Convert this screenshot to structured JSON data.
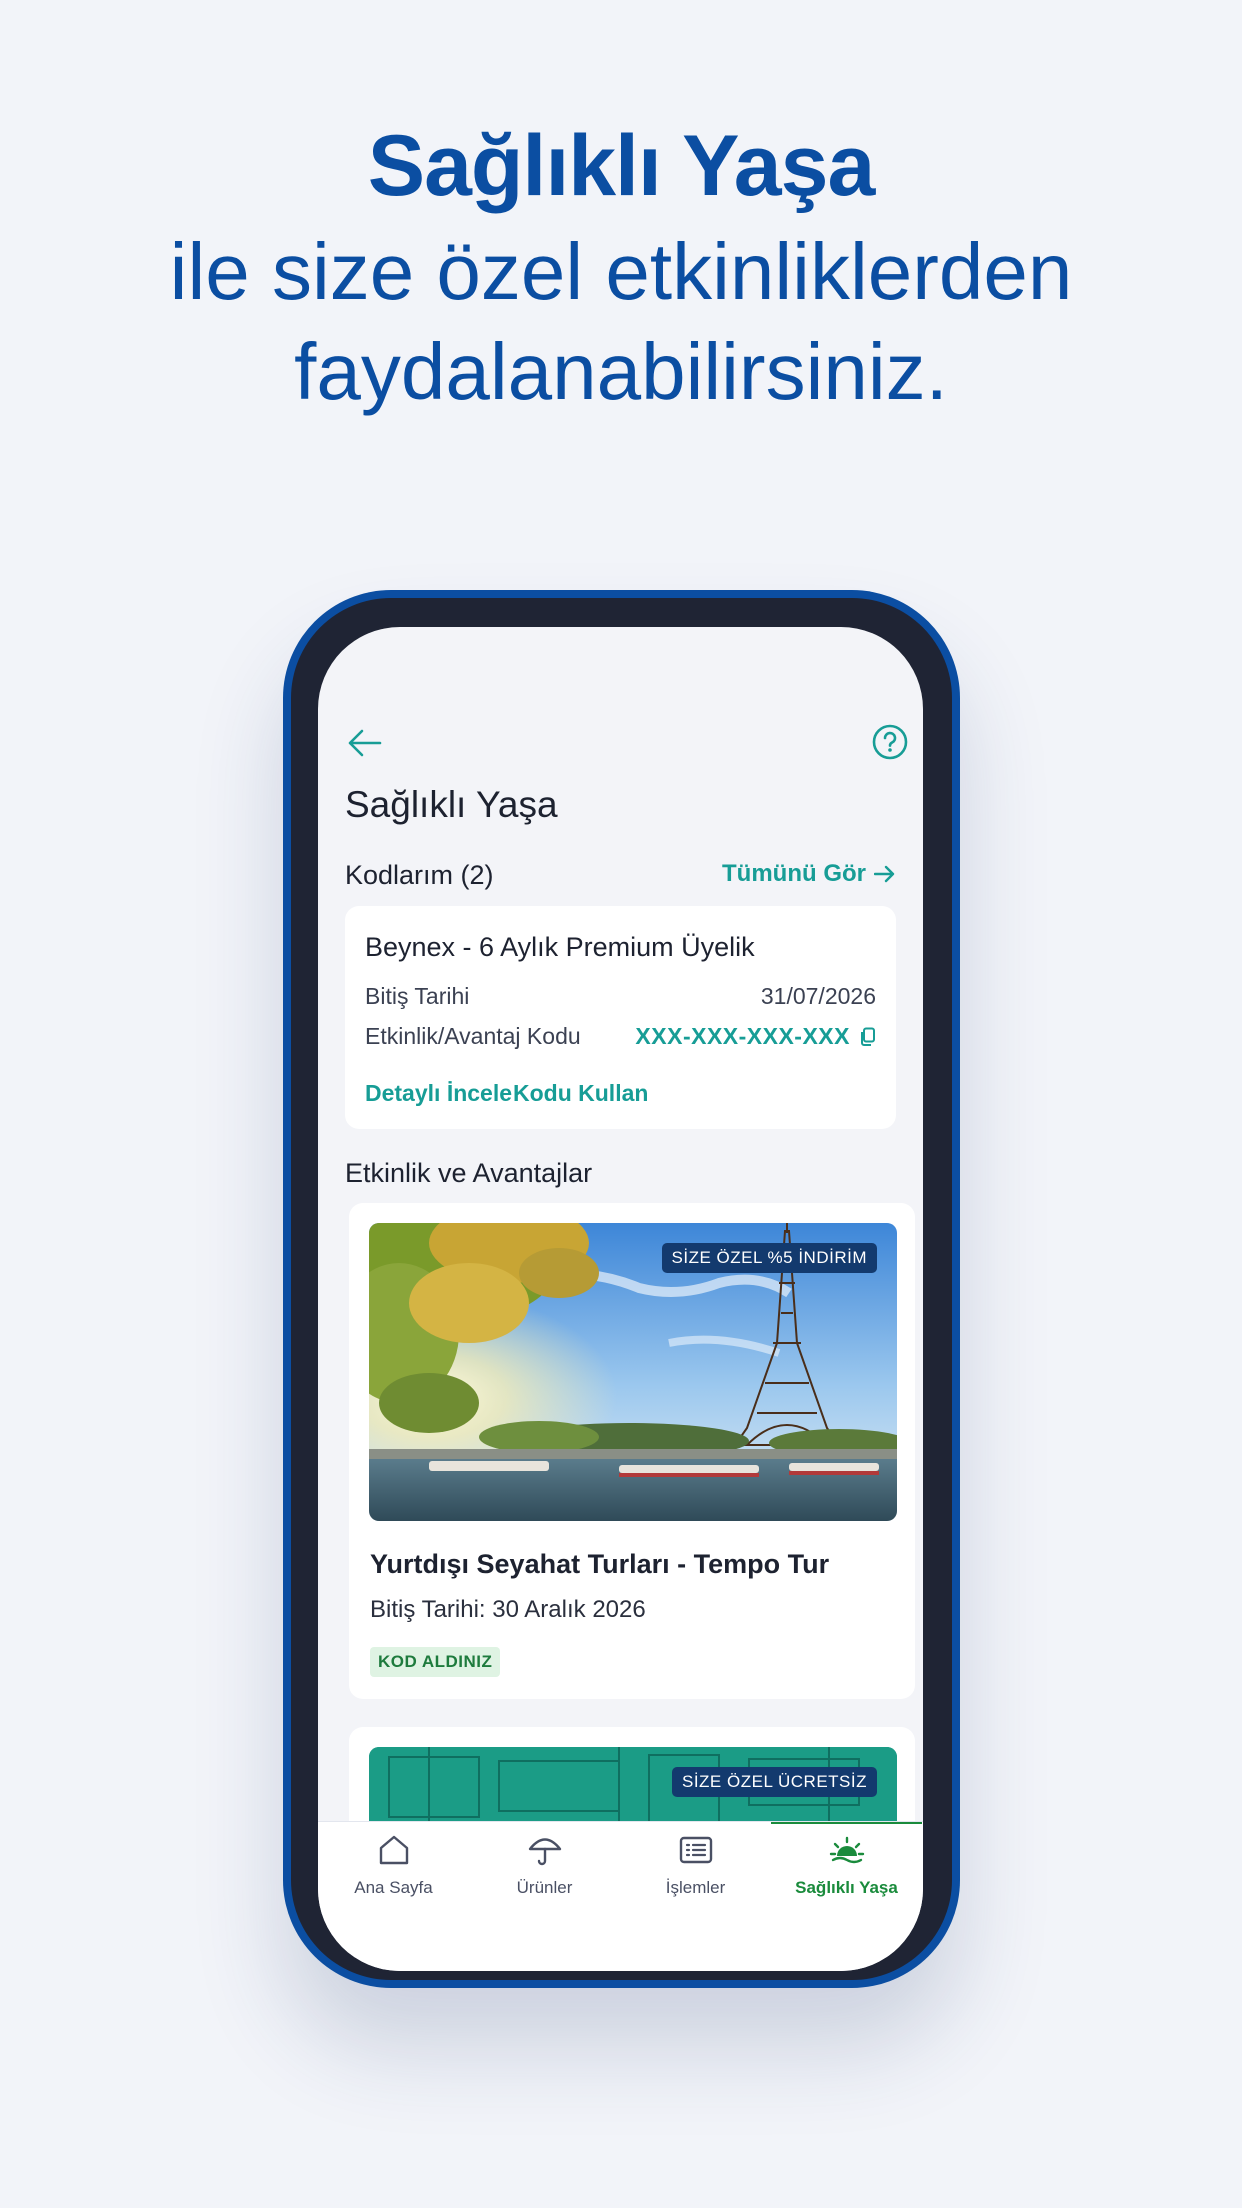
{
  "promo": {
    "title": "Sağlıklı Yaşa",
    "line1": "ile size özel etkinliklerden",
    "line2": "faydalanabilirsiniz."
  },
  "screen": {
    "title": "Sağlıklı Yaşa",
    "codes_section": {
      "heading": "Kodlarım (2)",
      "see_all": "Tümünü Gör",
      "card": {
        "title": "Beynex - 6 Aylık Premium Üyelik",
        "expiry_label": "Bitiş Tarihi",
        "expiry_value": "31/07/2026",
        "code_label": "Etkinlik/Avantaj Kodu",
        "code_value": "XXX-XXX-XXX-XXX",
        "detail_link": "Detaylı İncele",
        "use_link": "Kodu Kullan"
      }
    },
    "events_section": {
      "heading": "Etkinlik ve Avantajlar",
      "items": [
        {
          "badge": "SİZE ÖZEL %5 İNDİRİM",
          "title": "Yurtdışı Seyahat Turları - Tempo Tur",
          "date": "Bitiş Tarihi: 30 Aralık 2026",
          "tag": "KOD ALDINIZ"
        },
        {
          "badge": "SİZE ÖZEL ÜCRETSİZ"
        }
      ]
    }
  },
  "tabbar": {
    "items": [
      {
        "label": "Ana Sayfa",
        "icon": "home-icon"
      },
      {
        "label": "Ürünler",
        "icon": "umbrella-icon"
      },
      {
        "label": "İşlemler",
        "icon": "list-icon"
      },
      {
        "label": "Sağlıklı Yaşa",
        "icon": "sunrise-icon"
      }
    ],
    "active_index": 3
  },
  "colors": {
    "brand_blue": "#0b4ea2",
    "teal": "#179d96",
    "active_green": "#1a8b3c",
    "badge_navy": "#133a6e"
  }
}
